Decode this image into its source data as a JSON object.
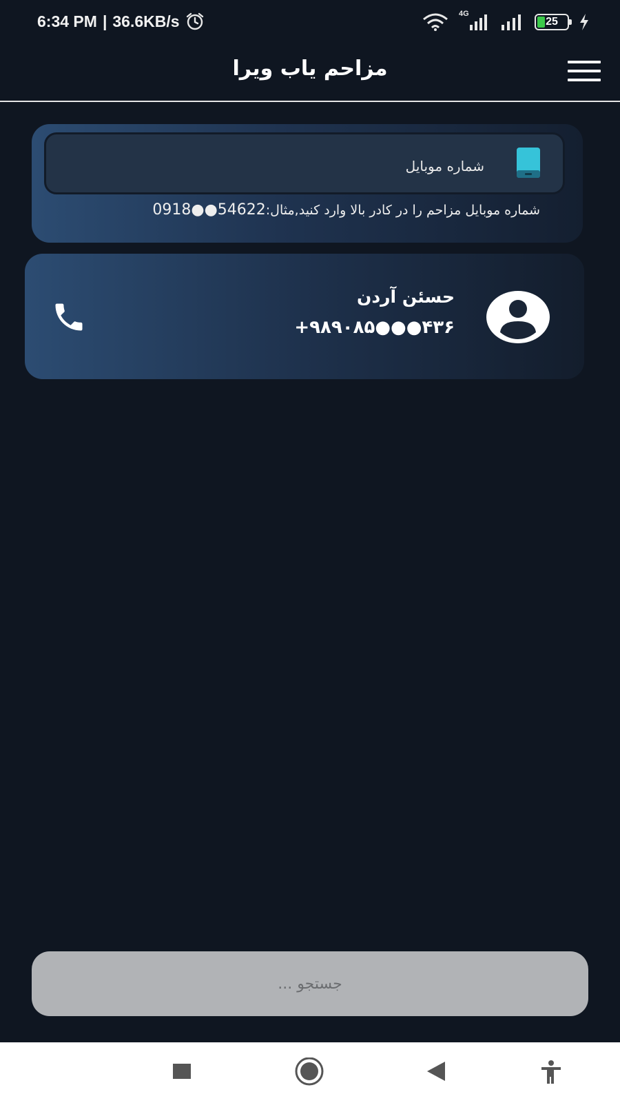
{
  "status_bar": {
    "time": "6:34 PM",
    "separator": "|",
    "speed": "36.6KB/s",
    "network_label": "4G",
    "battery": "25",
    "battery_fill_percent": 25,
    "icons": [
      "alarm-icon",
      "wifi-icon",
      "signal-icon",
      "battery-icon",
      "charging-icon"
    ]
  },
  "app_bar": {
    "title": "مزاحم یاب ویرا",
    "menu_icon": "hamburger-icon"
  },
  "search_card": {
    "field_label": "شماره موبایل",
    "field_icon": "mobile-phone-icon",
    "hint_text": "شماره موبایل مزاحم را در کادر بالا وارد کنید,مثال:",
    "hint_example": "0918●●54622"
  },
  "contact": {
    "name": "حسئن آردن",
    "number": "+۹۸۹۰۸۵●●●۴۳۶",
    "avatar_icon": "person-avatar-icon",
    "call_icon": "phone-call-icon"
  },
  "search": {
    "placeholder": "جستجو ..."
  },
  "nav": {
    "icons": [
      "recents-square-icon",
      "home-circle-icon",
      "back-triangle-icon",
      "accessibility-icon"
    ]
  },
  "colors": {
    "background": "#0f1621",
    "card_gradient_start": "#2c4c72",
    "field_background": "#233347",
    "mobile_icon": "#36c3d9",
    "search_background": "#b1b3b6",
    "battery_fill": "#3cc94a"
  }
}
